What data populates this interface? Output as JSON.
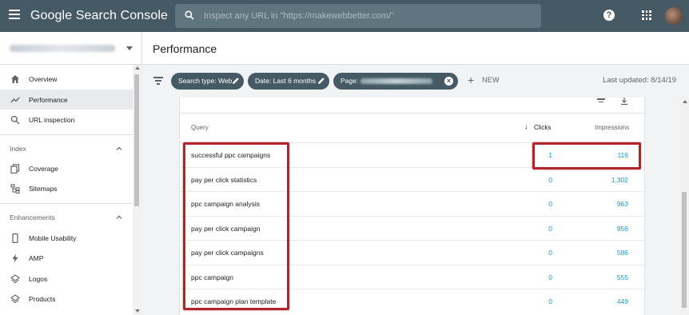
{
  "app": {
    "title": "Google Search Console"
  },
  "search": {
    "placeholder": "Inspect any URL in \"https://makewebbetter.com/\""
  },
  "page": {
    "title": "Performance"
  },
  "sidebar": {
    "items": [
      {
        "label": "Overview",
        "icon": "home-icon"
      },
      {
        "label": "Performance",
        "icon": "trend-icon",
        "active": true
      },
      {
        "label": "URL inspection",
        "icon": "search-icon"
      }
    ],
    "sections": [
      {
        "label": "Index",
        "items": [
          {
            "label": "Coverage",
            "icon": "coverage-icon"
          },
          {
            "label": "Sitemaps",
            "icon": "sitemap-icon"
          }
        ]
      },
      {
        "label": "Enhancements",
        "items": [
          {
            "label": "Mobile Usability",
            "icon": "phone-icon"
          },
          {
            "label": "AMP",
            "icon": "bolt-icon"
          },
          {
            "label": "Logos",
            "icon": "layers-icon"
          },
          {
            "label": "Products",
            "icon": "layers-icon"
          }
        ]
      }
    ]
  },
  "filters": {
    "chips": [
      {
        "label": "Search type: Web"
      },
      {
        "label": "Date: Last 6 months"
      },
      {
        "label": "Page: "
      }
    ],
    "new_label": "NEW",
    "last_updated": "Last updated: 8/14/19"
  },
  "table": {
    "columns": {
      "query": "Query",
      "clicks": "Clicks",
      "impressions": "Impressions"
    },
    "sort_arrow": "↓",
    "rows": [
      {
        "query": "successful ppc campaigns",
        "clicks": "1",
        "impressions": "116"
      },
      {
        "query": "pay per click statistics",
        "clicks": "0",
        "impressions": "1,302"
      },
      {
        "query": "ppc campaign analysis",
        "clicks": "0",
        "impressions": "963"
      },
      {
        "query": "pay per click campaign",
        "clicks": "0",
        "impressions": "956"
      },
      {
        "query": "pay per click campaigns",
        "clicks": "0",
        "impressions": "586"
      },
      {
        "query": "ppc campaign",
        "clicks": "0",
        "impressions": "555"
      },
      {
        "query": "ppc campaign plan template",
        "clicks": "0",
        "impressions": "449"
      }
    ]
  },
  "colors": {
    "appbar": "#455a64",
    "link": "#1a9bbf",
    "highlight": "#b3232a",
    "active_nav": "#e8eaed"
  }
}
